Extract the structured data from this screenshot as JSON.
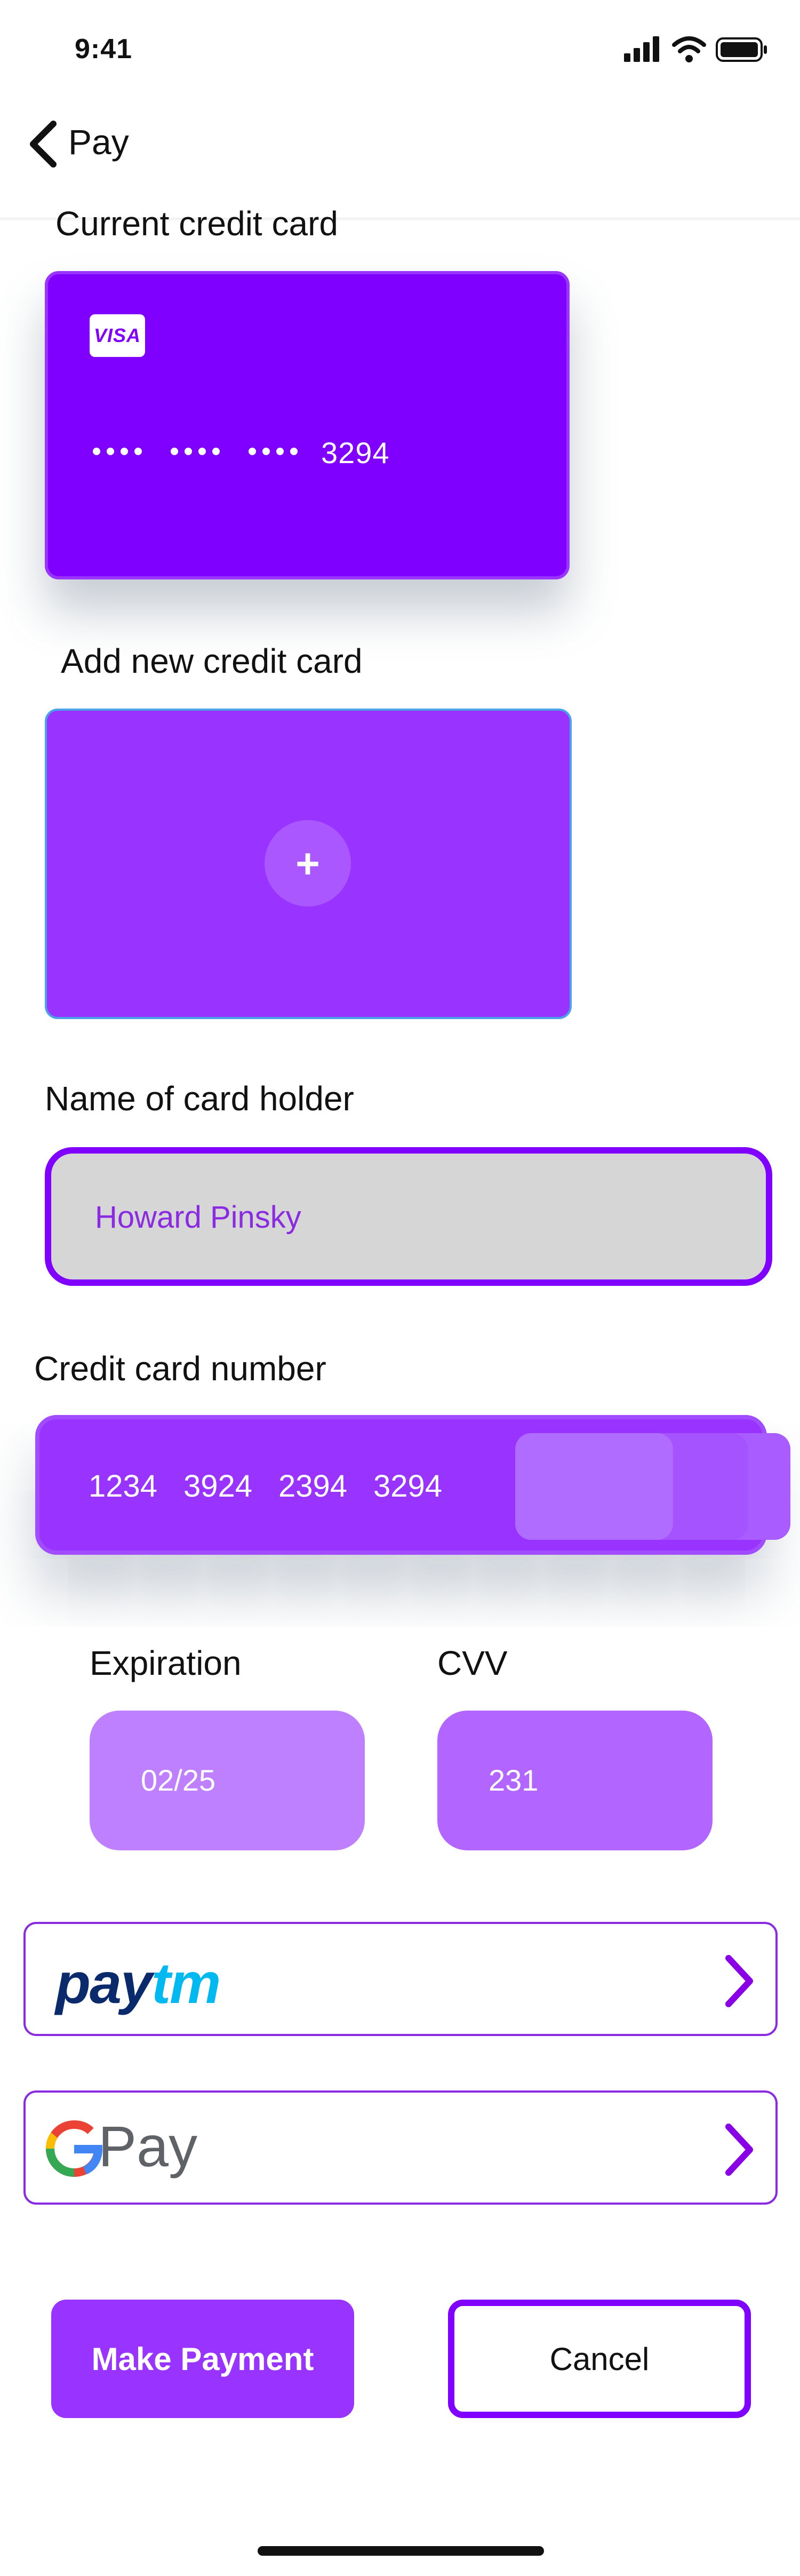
{
  "status_bar": {
    "time": "9:41",
    "icons": [
      "signal-icon",
      "wifi-icon",
      "battery-icon"
    ]
  },
  "header": {
    "back_icon": "chevron-left-icon",
    "title": "Pay"
  },
  "current_card": {
    "label": "Current credit card",
    "brand": "VISA",
    "masked": "•••• •••• ••••",
    "last4": "3294",
    "color": "#7f00ff"
  },
  "new_card": {
    "label": "Add new credit card",
    "add_icon": "+",
    "color": "#9933ff"
  },
  "card_holder": {
    "label": "Name of card holder",
    "value": "Howard Pinsky"
  },
  "card_number": {
    "label": "Credit card number",
    "groups": [
      "1234",
      "3924",
      "2394",
      "3294"
    ]
  },
  "expiration": {
    "label": "Expiration",
    "value": "02/25"
  },
  "cvv": {
    "label": "CVV",
    "value": "231"
  },
  "payment_options": [
    {
      "name": "paytm",
      "logo_part1": "pay",
      "logo_part2": "tm",
      "chevron": "chevron-right-icon"
    },
    {
      "name": "gpay",
      "logo_text": "Pay",
      "chevron": "chevron-right-icon"
    }
  ],
  "actions": {
    "primary": "Make Payment",
    "secondary": "Cancel"
  },
  "colors": {
    "accent": "#7f00ff",
    "accent_light": "#9933ff",
    "text_value": "#8a2be2"
  }
}
